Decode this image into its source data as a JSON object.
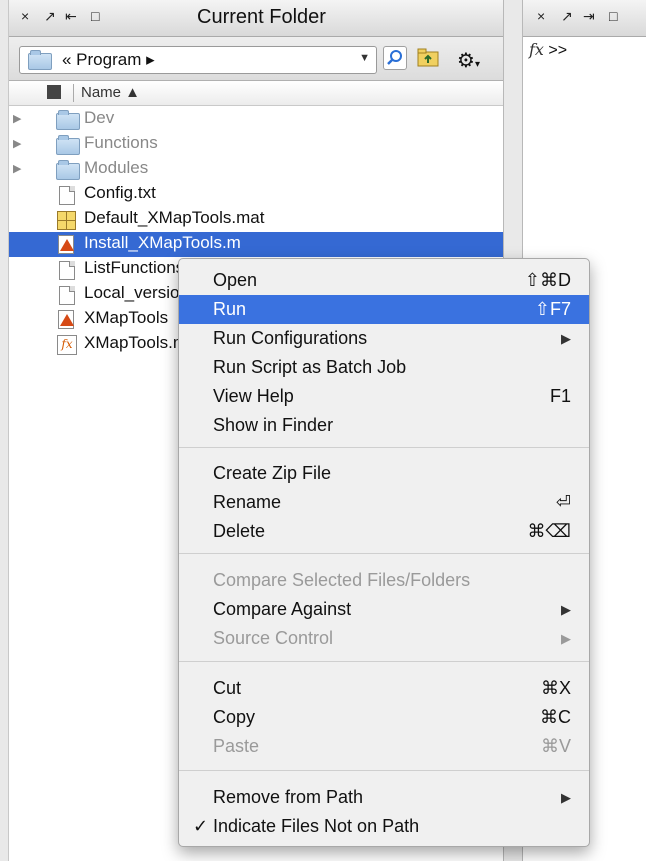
{
  "left_panel": {
    "title": "Current Folder",
    "controls": [
      "×",
      "↗",
      "⇤",
      "□"
    ],
    "path": "« Program ▸",
    "column_header": "Name ▲",
    "files": [
      {
        "name": "Dev",
        "type": "folder",
        "expandable": true,
        "dim": true
      },
      {
        "name": "Functions",
        "type": "folder",
        "expandable": true,
        "dim": true
      },
      {
        "name": "Modules",
        "type": "folder",
        "expandable": true,
        "dim": true
      },
      {
        "name": "Config.txt",
        "type": "text"
      },
      {
        "name": "Default_XMapTools.mat",
        "type": "mat"
      },
      {
        "name": "Install_XMapTools.m",
        "type": "script",
        "selected": true
      },
      {
        "name": "ListFunctions",
        "type": "text"
      },
      {
        "name": "Local_version",
        "type": "text"
      },
      {
        "name": "XMapTools",
        "type": "script"
      },
      {
        "name": "XMapTools.m",
        "type": "function"
      }
    ]
  },
  "right_panel": {
    "controls": [
      "×",
      "↗",
      "⇥",
      "□"
    ],
    "prompt_fx": "fx",
    "prompt": ">>"
  },
  "context_menu": {
    "groups": [
      [
        {
          "label": "Open",
          "shortcut": "⇧⌘D"
        },
        {
          "label": "Run",
          "shortcut": "⇧F7",
          "highlighted": true
        },
        {
          "label": "Run Configurations",
          "submenu": true
        },
        {
          "label": "Run Script as Batch Job"
        },
        {
          "label": "View Help",
          "shortcut": "F1"
        },
        {
          "label": "Show in Finder"
        }
      ],
      [
        {
          "label": "Create Zip File"
        },
        {
          "label": "Rename",
          "shortcut": "⏎"
        },
        {
          "label": "Delete",
          "shortcut": "⌘⌫"
        }
      ],
      [
        {
          "label": "Compare Selected Files/Folders",
          "disabled": true
        },
        {
          "label": "Compare Against",
          "submenu": true
        },
        {
          "label": "Source Control",
          "submenu": true,
          "disabled": true
        }
      ],
      [
        {
          "label": "Cut",
          "shortcut": "⌘X"
        },
        {
          "label": "Copy",
          "shortcut": "⌘C"
        },
        {
          "label": "Paste",
          "shortcut": "⌘V",
          "disabled": true
        }
      ],
      [
        {
          "label": "Remove from Path",
          "submenu": true
        },
        {
          "label": "Indicate Files Not on Path",
          "checked": true
        }
      ]
    ],
    "submenu_arrow": "▶",
    "check_mark": "✓"
  },
  "colors": {
    "selection": "#3569d3",
    "menu_highlight": "#3a72e0",
    "disabled": "#9a9a9a"
  }
}
